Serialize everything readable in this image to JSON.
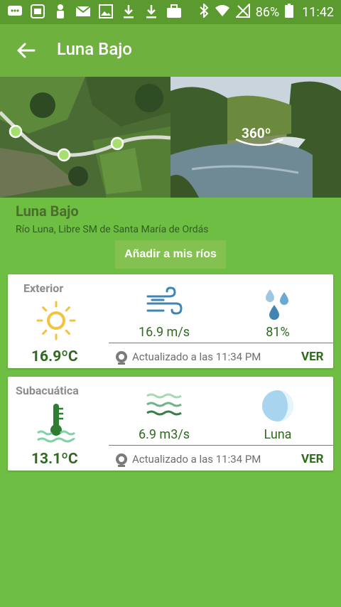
{
  "status_bar": {
    "battery_percent": "86%",
    "time": "11:42",
    "icons": [
      "message-icon",
      "image-app-icon",
      "person-icon",
      "mail-icon",
      "gallery-icon",
      "download-icon",
      "download-icon",
      "briefcase-icon",
      "bluetooth-icon",
      "wifi-icon",
      "no-signal-icon",
      "battery-icon"
    ]
  },
  "app_bar": {
    "title": "Luna Bajo"
  },
  "hero": {
    "badge": "360º"
  },
  "river": {
    "name": "Luna Bajo",
    "subtitle": "Río Luna, Libre SM de Santa María de Ordás",
    "add_button": "Añadir a mis ríos"
  },
  "exterior": {
    "label": "Exterior",
    "temperature": "16.9ºC",
    "wind": "16.9 m/s",
    "humidity": "81%",
    "updated": "Actualizado a las 11:34 PM",
    "ver": "VER"
  },
  "subacuatica": {
    "label": "Subacuática",
    "temperature": "13.1ºC",
    "flow": "6.9 m3/s",
    "moon": "Luna",
    "updated": "Actualizado a las 11:34 PM",
    "ver": "VER"
  },
  "colors": {
    "background": "#6fbe44",
    "app_bar": "#6fb13e",
    "status_bar": "#5b9a2e",
    "accent_text": "#2f6a1f",
    "sun": "#f3c33d",
    "water_blue": "#3f86b4"
  }
}
